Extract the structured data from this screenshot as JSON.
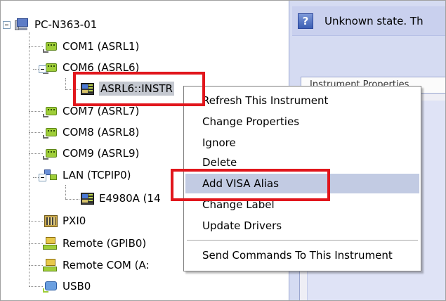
{
  "status": {
    "icon": "help-icon",
    "text": "Unknown state. Th"
  },
  "instrument_tab": {
    "label": "Instrument Properties"
  },
  "tree": {
    "root": {
      "label": "PC-N363-01",
      "icon": "computer-icon"
    },
    "items": [
      {
        "label": "COM1 (ASRL1)",
        "icon": "serial-port-icon"
      },
      {
        "label": "COM6 (ASRL6)",
        "icon": "serial-port-icon"
      },
      {
        "label": "ASRL6::INSTR",
        "icon": "instrument-icon"
      },
      {
        "label": "COM7 (ASRL7)",
        "icon": "serial-port-icon"
      },
      {
        "label": "COM8 (ASRL8)",
        "icon": "serial-port-icon"
      },
      {
        "label": "COM9 (ASRL9)",
        "icon": "serial-port-icon"
      },
      {
        "label": "LAN (TCPIP0)",
        "icon": "lan-icon"
      },
      {
        "label": "E4980A (14",
        "icon": "instrument-icon"
      },
      {
        "label": "PXI0",
        "icon": "pxi-icon"
      },
      {
        "label": "Remote (GPIB0)",
        "icon": "remote-icon"
      },
      {
        "label": "Remote COM (A:",
        "icon": "remote-icon"
      },
      {
        "label": "USB0",
        "icon": "usb-icon"
      }
    ]
  },
  "context_menu": {
    "items": [
      "Refresh This Instrument",
      "Change Properties",
      "Ignore",
      "Delete",
      "Add VISA Alias",
      "Change Label",
      "Update Drivers",
      "Send Commands To This Instrument"
    ],
    "hovered": "Add VISA Alias"
  },
  "colors": {
    "highlight_red": "#e1161c",
    "menu_hover": "#c2cbe3",
    "panel_blue": "#d5dbf2"
  }
}
